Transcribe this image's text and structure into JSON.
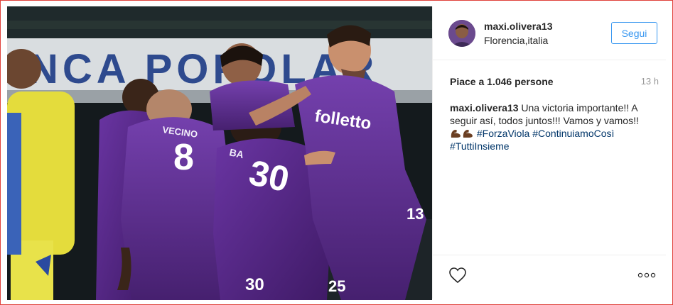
{
  "post": {
    "username": "maxi.olivera13",
    "location": "Florencia,italia",
    "follow_label": "Segui",
    "likes_text": "Piace a 1.046 persone",
    "time_ago": "13 h",
    "caption": {
      "user": "maxi.olivera13",
      "text": "Una victoria importante!! A seguir así, todos juntos!!! Vamos y vamos!!",
      "hashtags": [
        "#ForzaViola",
        "#ContinuiamoCosì",
        "#TuttiInsieme"
      ]
    },
    "photo": {
      "banner_text": "NCA POPOLAR",
      "sponsor_text": "folletto",
      "jersey_numbers": [
        "8",
        "30",
        "13",
        "30",
        "25"
      ],
      "jersey_names": [
        "VECINO",
        "BA"
      ]
    }
  },
  "icons": {
    "like": "heart-icon",
    "options": "more-options-icon",
    "emoji": "flexed-biceps-emoji"
  },
  "colors": {
    "accent": "#3897f0",
    "border": "#e0413b",
    "kit_purple": "#5b2a8c",
    "opponent_yellow": "#e9e13a"
  }
}
